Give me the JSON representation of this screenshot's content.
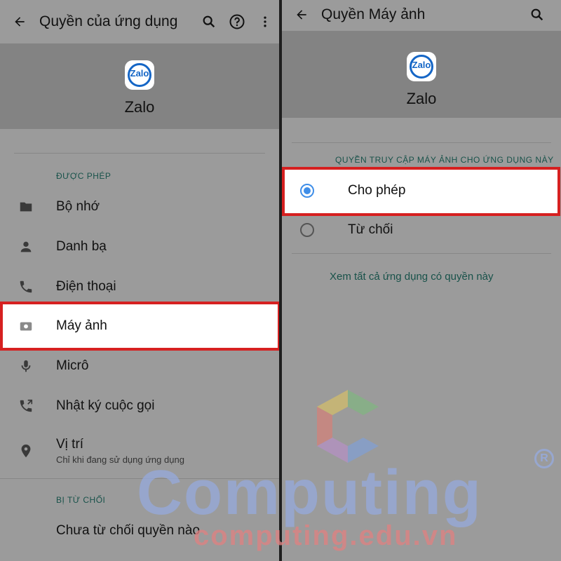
{
  "left": {
    "toolbar": {
      "title": "Quyền của ứng dụng"
    },
    "app": {
      "name": "Zalo",
      "logo_text": "Zalo"
    },
    "allowed_header": "ĐƯỢC PHÉP",
    "allowed": [
      {
        "label": "Bộ nhớ",
        "icon": "folder-icon"
      },
      {
        "label": "Danh bạ",
        "icon": "person-icon"
      },
      {
        "label": "Điện thoại",
        "icon": "phone-icon"
      },
      {
        "label": "Máy ảnh",
        "icon": "camera-icon"
      },
      {
        "label": "Micrô",
        "icon": "microphone-icon"
      },
      {
        "label": "Nhật ký cuộc gọi",
        "icon": "call-log-icon"
      },
      {
        "label": "Vị trí",
        "sub": "Chỉ khi đang sử dụng ứng dụng",
        "icon": "location-icon"
      }
    ],
    "denied_header": "BỊ TỪ CHỐI",
    "denied_empty": "Chưa từ chối quyền nào"
  },
  "right": {
    "toolbar": {
      "title": "Quyền Máy ảnh"
    },
    "app": {
      "name": "Zalo",
      "logo_text": "Zalo"
    },
    "access_header": "QUYỀN TRUY CẬP MÁY ẢNH CHO ỨNG DỤNG NÀY",
    "options": [
      {
        "label": "Cho phép",
        "selected": true
      },
      {
        "label": "Từ chối",
        "selected": false
      }
    ],
    "see_all": "Xem tất cả ứng dụng có quyền này"
  },
  "watermark": {
    "brand": "Computing",
    "url": "computing.edu.vn",
    "reg": "R"
  },
  "colors": {
    "highlight_border": "#d62020",
    "radio_accent": "#3f8ee8",
    "zalo_blue": "#1566c6",
    "teal_label": "#18524a"
  }
}
